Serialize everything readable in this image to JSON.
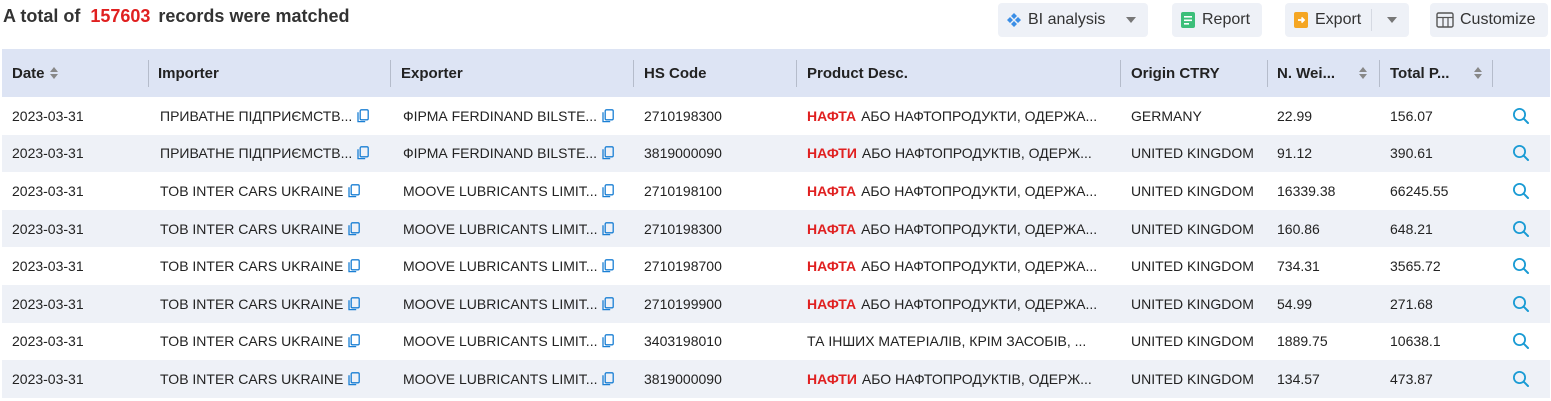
{
  "summary": {
    "prefix": "A total of",
    "count": "157603",
    "suffix": "records were matched"
  },
  "toolbar": {
    "bi_label": "BI analysis",
    "report_label": "Report",
    "export_label": "Export",
    "customize_label": "Customize"
  },
  "columns": {
    "date": "Date",
    "importer": "Importer",
    "exporter": "Exporter",
    "hs_code": "HS Code",
    "product_desc": "Product Desc.",
    "origin": "Origin CTRY",
    "net_weight": "N. Wei...",
    "total_price": "Total P..."
  },
  "colors": {
    "accent": "#1a7fd4",
    "highlight": "#e02020",
    "header_bg": "#dde4f4",
    "stripe": "#eef1f7"
  },
  "rows": [
    {
      "date": "2023-03-31",
      "importer": "ПРИВАТНЕ ПІДПРИЄМСТВ...",
      "exporter": "ФІРМА FERDINAND BILSTE...",
      "hs": "2710198300",
      "kw": "НАФТА",
      "desc": "АБО НАФТОПРОДУКТИ, ОДЕРЖА...",
      "origin": "GERMANY",
      "weight": "22.99",
      "price": "156.07"
    },
    {
      "date": "2023-03-31",
      "importer": "ПРИВАТНЕ ПІДПРИЄМСТВ...",
      "exporter": "ФІРМА FERDINAND BILSTE...",
      "hs": "3819000090",
      "kw": "НАФТИ",
      "desc": "АБО НАФТОПРОДУКТІВ, ОДЕРЖ...",
      "origin": "UNITED KINGDOM",
      "weight": "91.12",
      "price": "390.61"
    },
    {
      "date": "2023-03-31",
      "importer": "TOB INTER CARS UKRAINE",
      "exporter": "MOOVE LUBRICANTS LIMIT...",
      "hs": "2710198100",
      "kw": "НАФТА",
      "desc": "АБО НАФТОПРОДУКТИ, ОДЕРЖА...",
      "origin": "UNITED KINGDOM",
      "weight": "16339.38",
      "price": "66245.55"
    },
    {
      "date": "2023-03-31",
      "importer": "TOB INTER CARS UKRAINE",
      "exporter": "MOOVE LUBRICANTS LIMIT...",
      "hs": "2710198300",
      "kw": "НАФТА",
      "desc": "АБО НАФТОПРОДУКТИ, ОДЕРЖА...",
      "origin": "UNITED KINGDOM",
      "weight": "160.86",
      "price": "648.21"
    },
    {
      "date": "2023-03-31",
      "importer": "TOB INTER CARS UKRAINE",
      "exporter": "MOOVE LUBRICANTS LIMIT...",
      "hs": "2710198700",
      "kw": "НАФТА",
      "desc": "АБО НАФТОПРОДУКТИ, ОДЕРЖА...",
      "origin": "UNITED KINGDOM",
      "weight": "734.31",
      "price": "3565.72"
    },
    {
      "date": "2023-03-31",
      "importer": "TOB INTER CARS UKRAINE",
      "exporter": "MOOVE LUBRICANTS LIMIT...",
      "hs": "2710199900",
      "kw": "НАФТА",
      "desc": "АБО НАФТОПРОДУКТИ, ОДЕРЖА...",
      "origin": "UNITED KINGDOM",
      "weight": "54.99",
      "price": "271.68"
    },
    {
      "date": "2023-03-31",
      "importer": "TOB INTER CARS UKRAINE",
      "exporter": "MOOVE LUBRICANTS LIMIT...",
      "hs": "3403198010",
      "kw": "",
      "desc": "ТА ІНШИХ МАТЕРІАЛІВ, КРІМ ЗАСОБІВ, ...",
      "origin": "UNITED KINGDOM",
      "weight": "1889.75",
      "price": "10638.1"
    },
    {
      "date": "2023-03-31",
      "importer": "TOB INTER CARS UKRAINE",
      "exporter": "MOOVE LUBRICANTS LIMIT...",
      "hs": "3819000090",
      "kw": "НАФТИ",
      "desc": "АБО НАФТОПРОДУКТІВ, ОДЕРЖ...",
      "origin": "UNITED KINGDOM",
      "weight": "134.57",
      "price": "473.87"
    }
  ]
}
